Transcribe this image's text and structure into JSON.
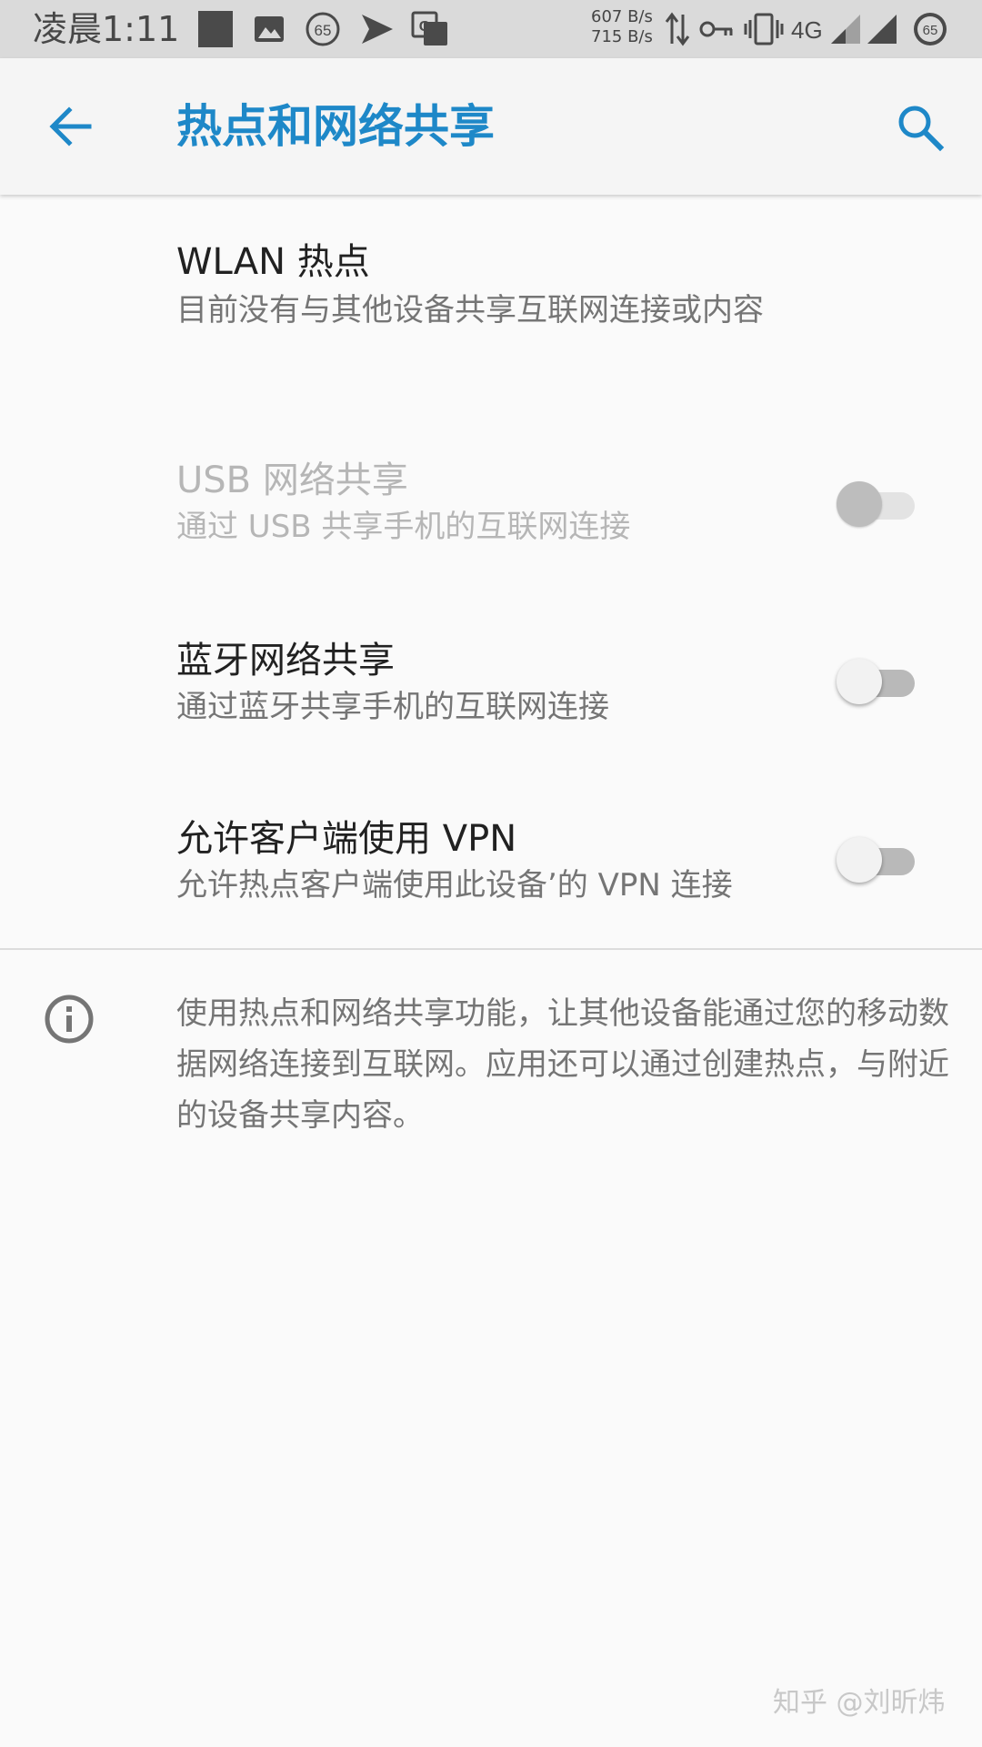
{
  "status_bar": {
    "time": "凌晨1:11",
    "speed_up": "607 B/s",
    "speed_down": "715 B/s",
    "network_type": "4G",
    "notification_badge": "65",
    "battery_level": "65"
  },
  "app_bar": {
    "title": "热点和网络共享",
    "accent_color": "#1e88c8"
  },
  "settings": [
    {
      "title": "WLAN 热点",
      "subtitle": "目前没有与其他设备共享互联网连接或内容",
      "has_switch": false,
      "enabled": true
    },
    {
      "title": "USB 网络共享",
      "subtitle": "通过 USB 共享手机的互联网连接",
      "has_switch": true,
      "checked": false,
      "enabled": false
    },
    {
      "title": "蓝牙网络共享",
      "subtitle": "通过蓝牙共享手机的互联网连接",
      "has_switch": true,
      "checked": false,
      "enabled": true
    },
    {
      "title": "允许客户端使用 VPN",
      "subtitle": "允许热点客户端使用此设备’的 VPN 连接",
      "has_switch": true,
      "checked": false,
      "enabled": true
    }
  ],
  "info": {
    "text": "使用热点和网络共享功能，让其他设备能通过您的移动数据网络连接到互联网。应用还可以通过创建热点，与附近的设备共享内容。"
  },
  "watermark": "知乎 @刘昕炜"
}
